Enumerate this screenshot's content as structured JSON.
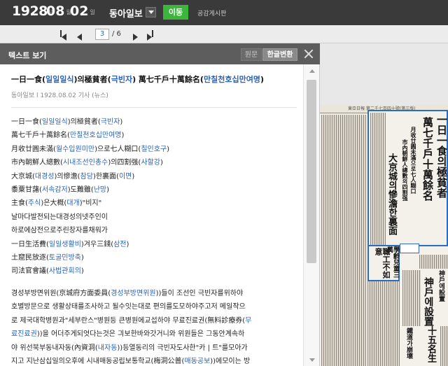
{
  "topbar": {
    "year": "1928",
    "year_unit": "년",
    "month": "08",
    "month_unit": "월",
    "day": "02",
    "day_unit": "일",
    "newspaper": "동아일보",
    "go_label": "이동",
    "board_link": "공감게시판"
  },
  "pager": {
    "current_page": "3",
    "total_pages": "/ 6"
  },
  "panel": {
    "title": "텍스트 보기",
    "tab_original": "원문",
    "tab_convert": "한글변환"
  },
  "article": {
    "title_parts": [
      "一日一食(",
      "일일일식",
      ")의極貧者(",
      "극빈자",
      ") 萬七千戶十萬餘名(",
      "만칠천호십만여명",
      ")"
    ],
    "meta": "동아일보 l 1928.08.02 기사 (뉴스)",
    "lines": [
      [
        "一日一食(",
        "일일일식",
        ")의極貧者(",
        "극빈자",
        ")"
      ],
      [
        "萬七千戶十萬餘名(",
        "만칠천호십만여명",
        ")"
      ],
      [
        "月收廿圓未滿(",
        "월수입원미만",
        ")으로七人糊口(",
        "칠인호구",
        ")"
      ],
      [
        "市內朝鮮人總數(",
        "시내조선인총수",
        ")의四割强(",
        "사할강",
        ")"
      ],
      [
        "大京城(",
        "대경성",
        ")의慘澹(",
        "참담",
        ")한裏面(",
        "이면",
        ")"
      ],
      [
        "黍粟甘藷(",
        "서속감저",
        ")도難雖(",
        "난망",
        ")"
      ],
      [
        "主食(",
        "주식",
        ")은大概(",
        "대개",
        ")\"비지\""
      ],
      [
        "날마다발전되는대경성의넷주인이"
      ],
      [
        "하로에삼전으로주린창자를채워가"
      ],
      [
        "一日生活費(",
        "일일생활비",
        ")겨우三錢(",
        "삼전",
        ")"
      ],
      [
        "土窟民放逐(",
        "토굴민방축",
        ")"
      ],
      [
        "司法官會議(",
        "사법관회의",
        ")"
      ]
    ],
    "paragraph_lines": [
      [
        "경성부방면위원(京城府方面委員(",
        "경성부방면위원",
        "))들이 조선인 극빈자를위하야"
      ],
      [
        "호별방문으로 생활상태를조사하고 될수잇는대로 편의를도모하야주고저 메일작으"
      ],
      [
        "로 제국대학병원과\"세부란스\"병원등 큰병원에교섭하야 무료진료권(無料診療券(",
        "무"
      ],
      [
        "료진료권",
        "))을 어더주게되엇다는것은 긔보한바와갓거니와 위원들은 그동안계속하"
      ],
      [
        "야 위선북부동내자동(內資洞(",
        "내자동",
        "))등열동리의 극빈자도사한\"카 | 트\"를모아가"
      ],
      [
        "지고 지난삼십일의오후에 시내매동공립보통학교(梅洞公普(",
        "매동공보",
        "))에모이는 방"
      ]
    ]
  },
  "scan": {
    "header": "東亞日報 第二千七百四十號(第三版)",
    "headline_1": "一日一食의極貧者",
    "headline_2": "萬七千戶十萬餘名",
    "sub_1": "月收廿圓未滿으로七人糊口",
    "sub_2": "市內朝鮮人總數의四割强",
    "sub_3": "大京城의慘澹한裏面",
    "side_1": "學齡兒童三萬",
    "side_2": "職工不如意",
    "side_3": "神戶에設置",
    "side_4": "十五名生",
    "side_5": "鐵道가崩壞"
  },
  "colors": {
    "topbar_bg": "#3a3a3a",
    "go_button": "#3db53d",
    "link_blue": "#2a62b8",
    "highlight_border": "#2d6cc0"
  }
}
